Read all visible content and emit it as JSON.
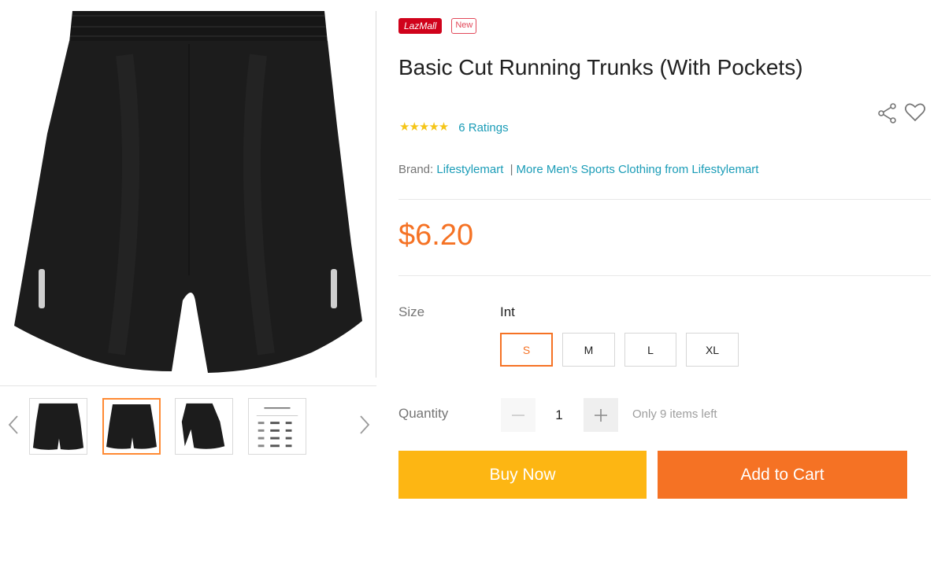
{
  "badges": {
    "mall": "LazMall",
    "new": "New"
  },
  "product": {
    "title": "Basic Cut Running Trunks (With Pockets)",
    "rating": {
      "stars": "★★★★★",
      "count_text": "6 Ratings"
    },
    "brand": {
      "label": "Brand:",
      "name": "Lifestylemart",
      "separator": "|",
      "more_link": "More Men's Sports Clothing from Lifestylemart"
    },
    "price": "$6.20"
  },
  "icons": {
    "share": "share-icon",
    "wishlist": "heart-icon",
    "prev": "chevron-left-icon",
    "next": "chevron-right-icon",
    "minus": "minus-icon",
    "plus": "plus-icon"
  },
  "size": {
    "label": "Size",
    "system": "Int",
    "options": [
      "S",
      "M",
      "L",
      "XL"
    ],
    "selected": "S"
  },
  "quantity": {
    "label": "Quantity",
    "value": "1",
    "stock_note": "Only 9 items left"
  },
  "actions": {
    "buy_now": "Buy Now",
    "add_to_cart": "Add to Cart"
  },
  "gallery": {
    "thumbnail_count": 4,
    "active_index": 1
  },
  "colors": {
    "price": "#f57224",
    "buy_now": "#fdb613",
    "add_to_cart": "#f57224",
    "link": "#1a9cb7",
    "stars": "#f5c518",
    "mall_badge": "#d0021b"
  }
}
